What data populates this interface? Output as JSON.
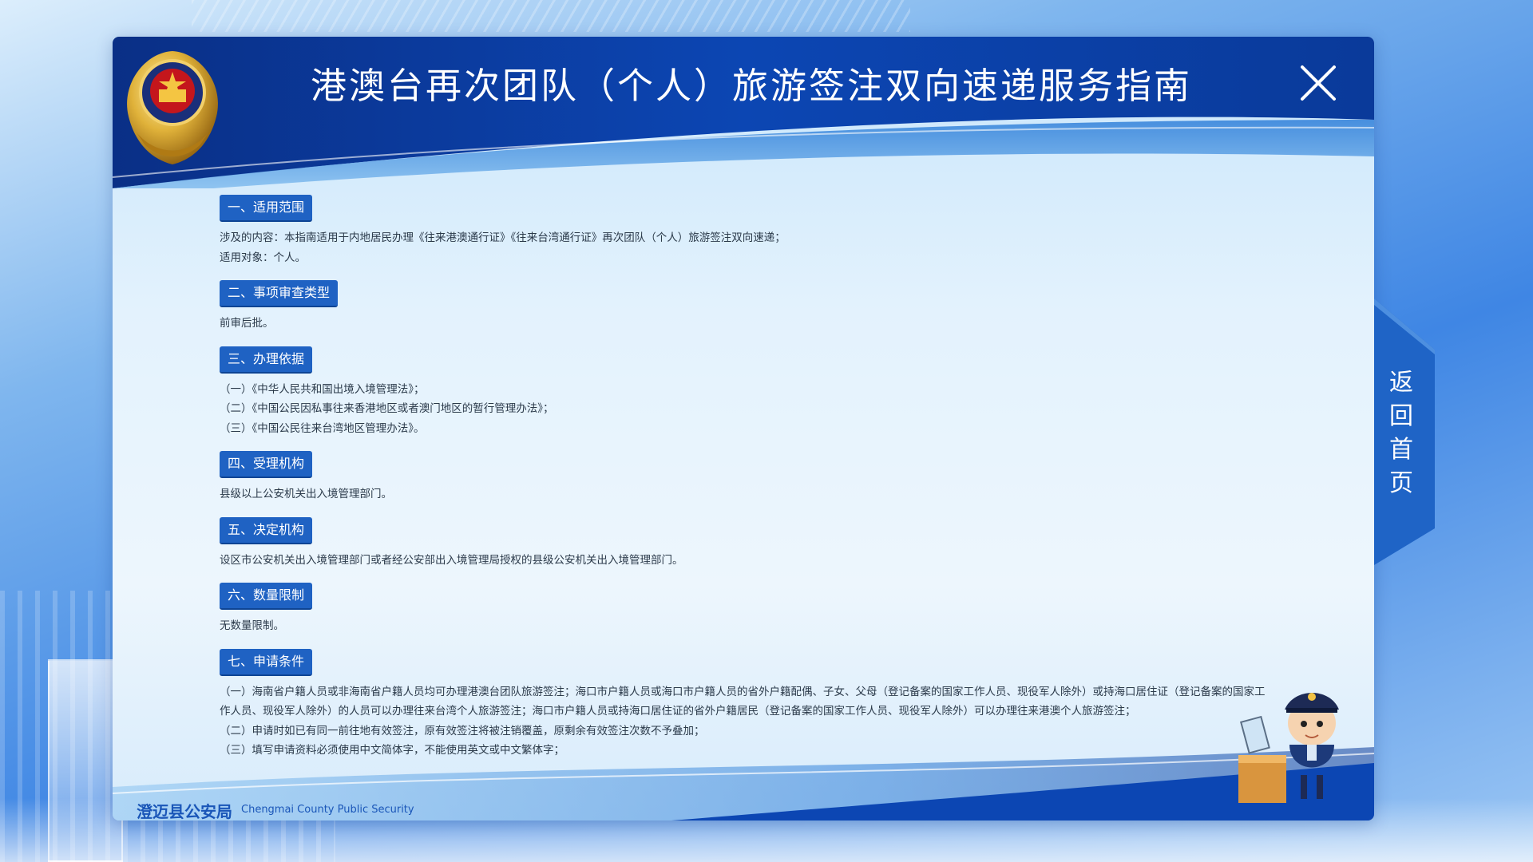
{
  "header": {
    "title": "港澳台再次团队（个人）旅游签注双向速递服务指南",
    "close_icon": "close-icon",
    "emblem_icon": "police-emblem-icon"
  },
  "sections": [
    {
      "title": "一、适用范围",
      "lines": [
        "涉及的内容：本指南适用于内地居民办理《往来港澳通行证》《往来台湾通行证》再次团队（个人）旅游签注双向速递；",
        "适用对象：个人。"
      ]
    },
    {
      "title": "二、事项审查类型",
      "lines": [
        "前审后批。"
      ]
    },
    {
      "title": "三、办理依据",
      "lines": [
        "（一）《中华人民共和国出境入境管理法》；",
        "（二）《中国公民因私事往来香港地区或者澳门地区的暂行管理办法》；",
        "（三）《中国公民往来台湾地区管理办法》。"
      ]
    },
    {
      "title": "四、受理机构",
      "lines": [
        "县级以上公安机关出入境管理部门。"
      ]
    },
    {
      "title": "五、决定机构",
      "lines": [
        "设区市公安机关出入境管理部门或者经公安部出入境管理局授权的县级公安机关出入境管理部门。"
      ]
    },
    {
      "title": "六、数量限制",
      "lines": [
        "无数量限制。"
      ]
    },
    {
      "title": "七、申请条件",
      "lines": [
        "（一）海南省户籍人员或非海南省户籍人员均可办理港澳台团队旅游签注；海口市户籍人员或海口市户籍人员的省外户籍配偶、子女、父母（登记备案的国家工作人员、现役军人除外）或持海口居住证（登记备案的国家工作人员、现役军人除外）的人员可以办理往来台湾个人旅游签注；海口市户籍人员或持海口居住证的省外户籍居民（登记备案的国家工作人员、现役军人除外）可以办理往来港澳个人旅游签注；",
        "（二）申请时如已有同一前往地有效签注，原有效签注将被注销覆盖，原剩余有效签注次数不予叠加；",
        "（三）填写申请资料必须使用中文简体字，不能使用英文或中文繁体字；"
      ]
    }
  ],
  "footer": {
    "brand_cn": "澄迈县公安局",
    "brand_en": "Chengmai County Public Security",
    "mascot_icon": "police-mascot-icon"
  },
  "side_tab": {
    "label": "返回首页"
  },
  "colors": {
    "header_blue": "#0b3f9c",
    "section_badge": "#1f62c3",
    "text": "#2b3a4a"
  }
}
